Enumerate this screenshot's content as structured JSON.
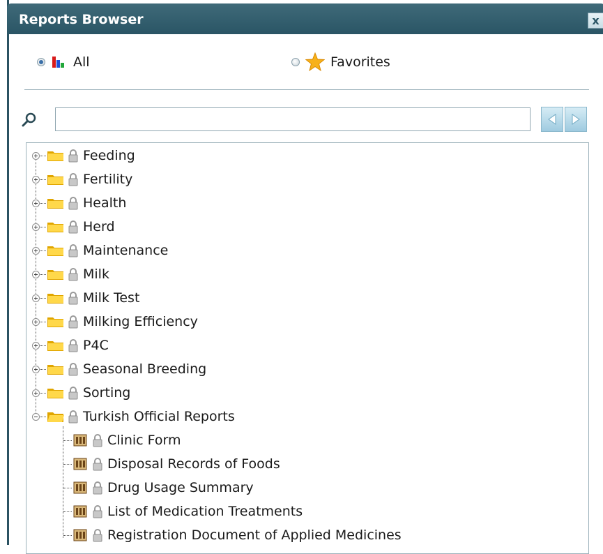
{
  "window": {
    "title": "Reports Browser",
    "close_glyph": "x",
    "close_icon": "close-icon"
  },
  "filter": {
    "all_label": "All",
    "favorites_label": "Favorites",
    "selected": "All"
  },
  "search": {
    "value": "",
    "placeholder": ""
  },
  "icons": {
    "search": "search-icon",
    "prev": "arrow-left-icon",
    "next": "arrow-right-icon",
    "folder": "folder-icon",
    "lock": "lock-icon",
    "report": "report-icon"
  },
  "colors": {
    "titlebar": "#2f5b6b",
    "border": "#2b5262",
    "folder": "#f5cf3a",
    "lock": "#a8a8a8",
    "report": "#8b5a2b"
  },
  "tree": {
    "folders": [
      {
        "label": "Feeding",
        "expanded": false
      },
      {
        "label": "Fertility",
        "expanded": false
      },
      {
        "label": "Health",
        "expanded": false
      },
      {
        "label": "Herd",
        "expanded": false
      },
      {
        "label": "Maintenance",
        "expanded": false
      },
      {
        "label": "Milk",
        "expanded": false
      },
      {
        "label": "Milk Test",
        "expanded": false
      },
      {
        "label": "Milking Efficiency",
        "expanded": false
      },
      {
        "label": "P4C",
        "expanded": false
      },
      {
        "label": "Seasonal Breeding",
        "expanded": false
      },
      {
        "label": "Sorting",
        "expanded": false
      },
      {
        "label": "Turkish Official Reports",
        "expanded": true
      }
    ],
    "reports": [
      {
        "label": "Clinic Form"
      },
      {
        "label": "Disposal Records of Foods"
      },
      {
        "label": "Drug Usage Summary"
      },
      {
        "label": "List of Medication Treatments"
      },
      {
        "label": "Registration Document of Applied Medicines"
      }
    ]
  }
}
